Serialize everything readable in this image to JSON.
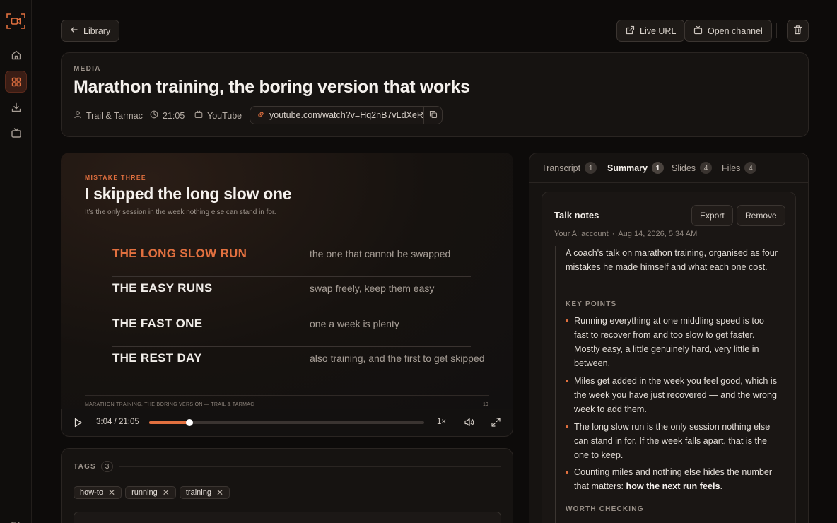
{
  "colors": {
    "accent": "#e2703f",
    "background": "#0d0b0a",
    "card": "#161311"
  },
  "rail": {
    "items": [
      {
        "icon": "home-icon"
      },
      {
        "icon": "grid-icon",
        "active": true
      },
      {
        "icon": "download-icon"
      },
      {
        "icon": "tv-icon"
      }
    ]
  },
  "toolbar": {
    "back_label": "Library",
    "live_url_label": "Live URL",
    "open_channel_label": "Open channel"
  },
  "media": {
    "section_label": "MEDIA",
    "title": "Marathon training, the boring version that works",
    "author": "Trail & Tarmac",
    "duration": "21:05",
    "platform": "YouTube",
    "url": "youtube.com/watch?v=Hq2nB7vLdXeR"
  },
  "slide": {
    "kicker": "MISTAKE THREE",
    "heading": "I skipped the long slow one",
    "subheading": "It’s the only session in the week nothing else can stand in for.",
    "rows": [
      {
        "key": "THE LONG SLOW RUN",
        "value": "the one that cannot be swapped",
        "highlight": true
      },
      {
        "key": "THE EASY RUNS",
        "value": "swap freely, keep them easy"
      },
      {
        "key": "THE FAST ONE",
        "value": "one a week is plenty"
      },
      {
        "key": "THE REST DAY",
        "value": "also training, and the first to get skipped"
      }
    ],
    "footer_left": "MARATHON TRAINING, THE BORING VERSION — TRAIL & TARMAC",
    "footer_right": "19"
  },
  "player": {
    "time": "3:04 / 21:05",
    "progress": 0.146,
    "speed": "1×"
  },
  "tags": {
    "label": "TAGS",
    "count": "3",
    "items": [
      "how-to",
      "running",
      "training"
    ]
  },
  "tabs": [
    {
      "label": "Transcript",
      "count": "1"
    },
    {
      "label": "Summary",
      "count": "1",
      "active": true
    },
    {
      "label": "Slides",
      "count": "4"
    },
    {
      "label": "Files",
      "count": "4"
    }
  ],
  "summary": {
    "title": "Talk notes",
    "export_label": "Export",
    "remove_label": "Remove",
    "account": "Your AI account",
    "date": "Aug 14, 2026, 5:34 AM",
    "intro": "A coach's talk on marathon training, organised as four mistakes he made himself and what each one cost.",
    "key_points_label": "KEY POINTS",
    "points": [
      "Running everything at one middling speed is too fast to recover from and too slow to get faster. Mostly easy, a little genuinely hard, very little in between.",
      "Miles get added in the week you feel good, which is the week you have just recovered — and the wrong week to add them.",
      "The long slow run is the only session nothing else can stand in for. If the week falls apart, that is the one to keep."
    ],
    "point4_prefix": "Counting miles and nothing else hides the number that matters: ",
    "point4_bold": "how the next run feels",
    "point4_suffix": ".",
    "worth_checking_label": "WORTH CHECKING"
  }
}
